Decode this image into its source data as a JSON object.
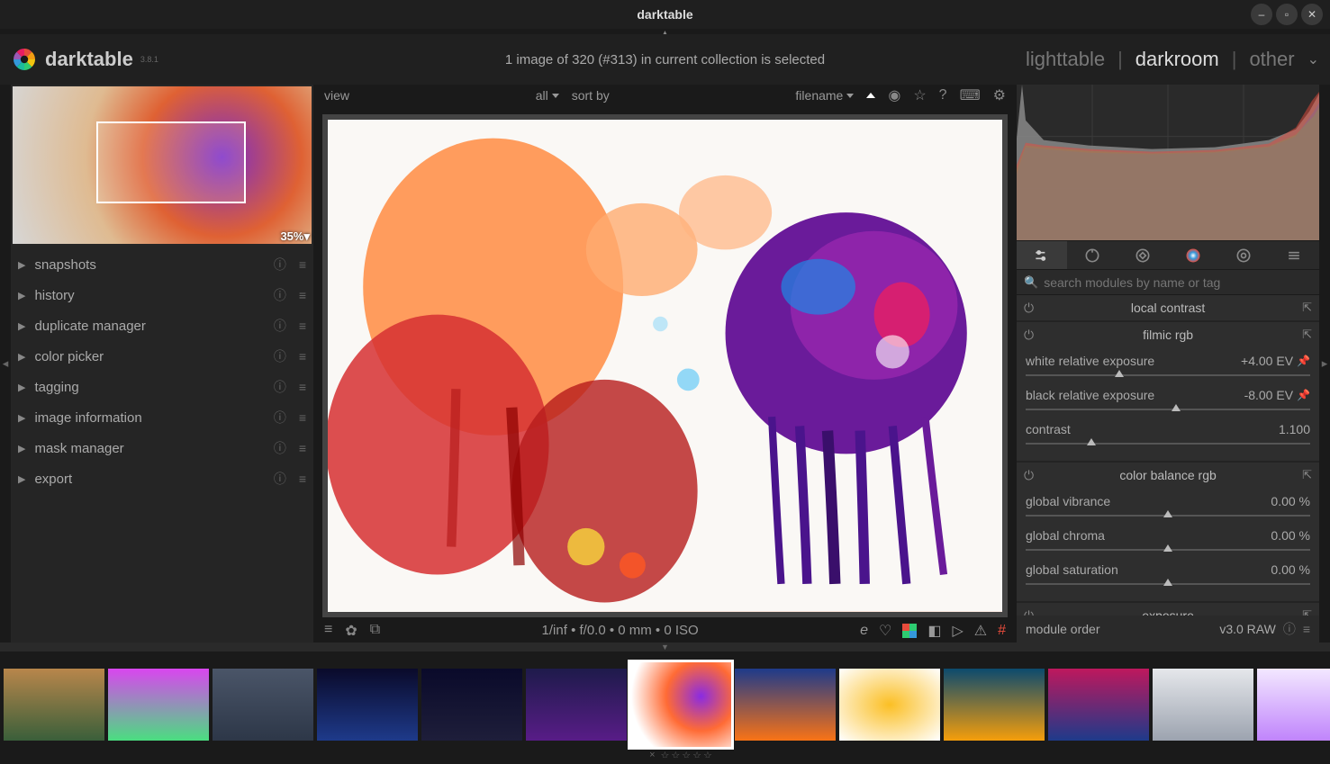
{
  "window_title": "darktable",
  "app": {
    "name": "darktable",
    "version": "3.8.1"
  },
  "collection_status": "1 image of 320 (#313) in current collection is selected",
  "views": {
    "lighttable": "lighttable",
    "darkroom": "darkroom",
    "other": "other",
    "active": "darkroom"
  },
  "nav_preview": {
    "zoom": "35%"
  },
  "left_modules": [
    "snapshots",
    "history",
    "duplicate manager",
    "color picker",
    "tagging",
    "image information",
    "mask manager",
    "export"
  ],
  "center_toolbar": {
    "view_label": "view",
    "filter": "all",
    "sortby_label": "sort by",
    "sort_field": "filename"
  },
  "image_info": "1/inf • f/0.0 • 0 mm • 0 ISO",
  "search_placeholder": "search modules by name or tag",
  "right_modules": [
    {
      "name": "local contrast",
      "params": []
    },
    {
      "name": "filmic rgb",
      "params": [
        {
          "label": "white relative exposure",
          "value": "+4.00 EV",
          "pin": true,
          "pos": 33
        },
        {
          "label": "black relative exposure",
          "value": "-8.00 EV",
          "pin": true,
          "pos": 53
        },
        {
          "label": "contrast",
          "value": "1.100",
          "pin": false,
          "pos": 23
        }
      ]
    },
    {
      "name": "color balance rgb",
      "params": [
        {
          "label": "global vibrance",
          "value": "0.00 %",
          "pin": false,
          "pos": 50
        },
        {
          "label": "global chroma",
          "value": "0.00 %",
          "pin": false,
          "pos": 50
        },
        {
          "label": "global saturation",
          "value": "0.00 %",
          "pin": false,
          "pos": 50
        }
      ]
    },
    {
      "name": "exposure",
      "params": []
    }
  ],
  "module_order": {
    "label": "module order",
    "value": "v3.0 RAW"
  },
  "filmstrip": {
    "count": 13,
    "selected_index": 6,
    "thumb_gradients": [
      "linear-gradient(#b8864b,#3a5f3a)",
      "linear-gradient(#d946ef,#4ade80)",
      "linear-gradient(#4a5568,#2d3748)",
      "linear-gradient(#0a0a2a,#1e3a8a)",
      "linear-gradient(#0a0a2a,#1e1e3a)",
      "linear-gradient(#1e1b4b,#581c87)",
      "radial-gradient(circle at 70% 40%,#8a2be2,#ff6b35 40%,#fff 80%)",
      "linear-gradient(#1e3a8a,#f97316)",
      "radial-gradient(#fbbf24,#fff)",
      "linear-gradient(#0c4a6e,#f59e0b)",
      "linear-gradient(#be185d,#1e3a8a)",
      "linear-gradient(#e5e7eb,#9ca3af)",
      "linear-gradient(#f3e8ff,#c084fc)"
    ]
  }
}
